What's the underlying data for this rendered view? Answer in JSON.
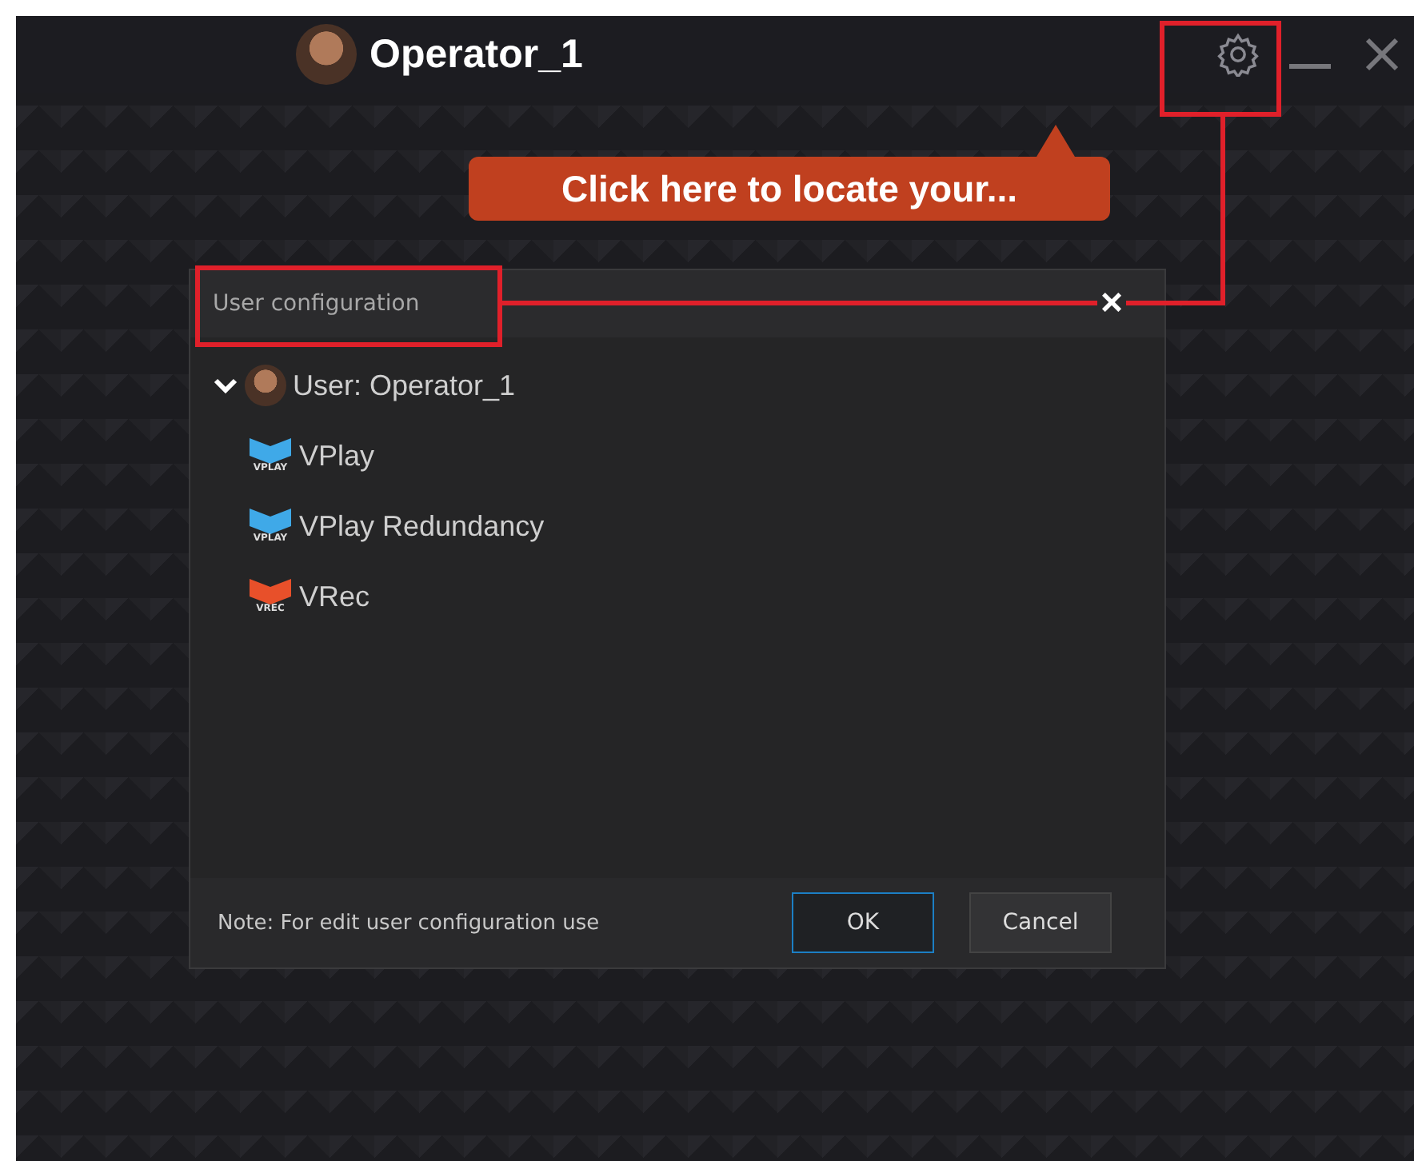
{
  "window": {
    "title": "Operator_1"
  },
  "callout": {
    "text": "Click here to locate your..."
  },
  "dialog": {
    "title": "User configuration",
    "close": "×",
    "tree": [
      {
        "label": "User: Operator_1",
        "expanded": true,
        "children": [
          {
            "label": "VPlay",
            "logo_text": "VPLAY",
            "color": "#3fa9e8"
          },
          {
            "label": "VPlay Redundancy",
            "logo_text": "VPLAY",
            "color": "#3fa9e8"
          },
          {
            "label": "VRec",
            "logo_text": "VREC",
            "color": "#e8502a"
          }
        ]
      }
    ],
    "note": "Note: For edit user configuration use",
    "buttons": [
      {
        "label": "OK",
        "selected": true
      },
      {
        "label": "Cancel",
        "selected": false
      }
    ]
  }
}
